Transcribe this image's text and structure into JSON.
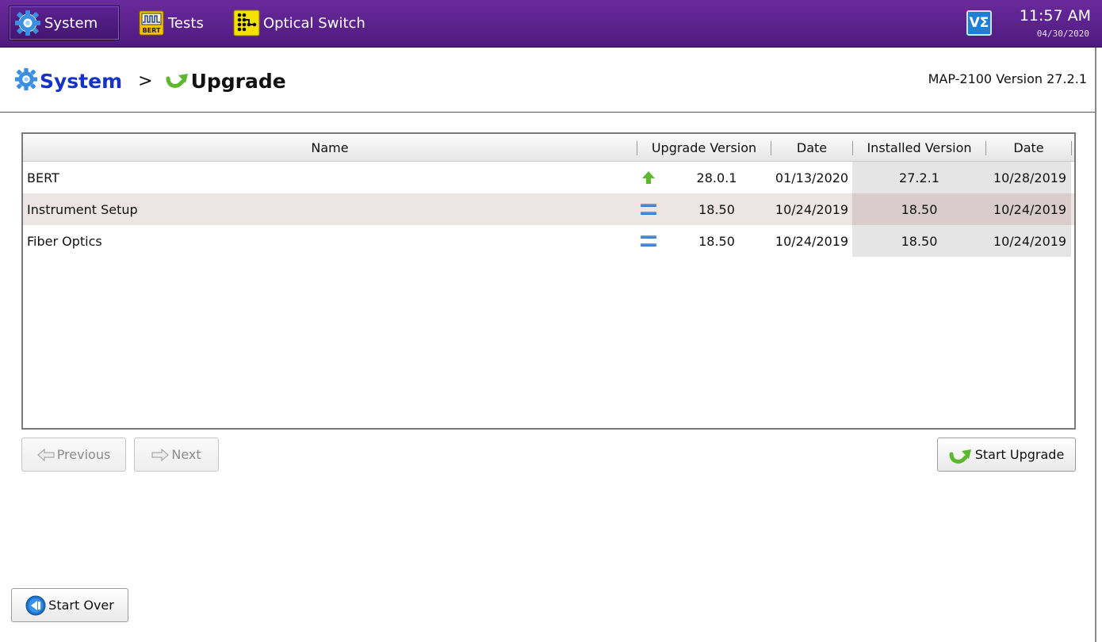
{
  "topbar": {
    "tabs": [
      {
        "label": "System",
        "icon": "gear-icon"
      },
      {
        "label": "Tests",
        "icon": "bert-icon",
        "icon_text": "BERT"
      },
      {
        "label": "Optical Switch",
        "icon": "optical-switch-icon"
      }
    ],
    "logo": "VΣ",
    "time": "11:57 AM",
    "date": "04/30/2020"
  },
  "breadcrumb": {
    "root": "System",
    "separator": ">",
    "current": "Upgrade"
  },
  "version": "MAP-2100 Version 27.2.1",
  "table": {
    "columns": [
      "Name",
      "Upgrade Version",
      "Date",
      "Installed Version",
      "Date"
    ],
    "rows": [
      {
        "name": "BERT",
        "status_icon": "up-arrow-icon",
        "upgrade_version": "28.0.1",
        "upgrade_date": "01/13/2020",
        "installed_version": "27.2.1",
        "installed_date": "10/28/2019"
      },
      {
        "name": "Instrument Setup",
        "status_icon": "equal-icon",
        "upgrade_version": "18.50",
        "upgrade_date": "10/24/2019",
        "installed_version": "18.50",
        "installed_date": "10/24/2019"
      },
      {
        "name": "Fiber Optics",
        "status_icon": "equal-icon",
        "upgrade_version": "18.50",
        "upgrade_date": "10/24/2019",
        "installed_version": "18.50",
        "installed_date": "10/24/2019"
      }
    ]
  },
  "buttons": {
    "previous": "Previous",
    "next": "Next",
    "start_upgrade": "Start Upgrade",
    "start_over": "Start Over"
  },
  "colors": {
    "topbar": "#5a2190",
    "breadcrumb_system": "#1632c9",
    "upgrade_arrow": "#5cb82e",
    "alt_row": "#ede4e4"
  }
}
